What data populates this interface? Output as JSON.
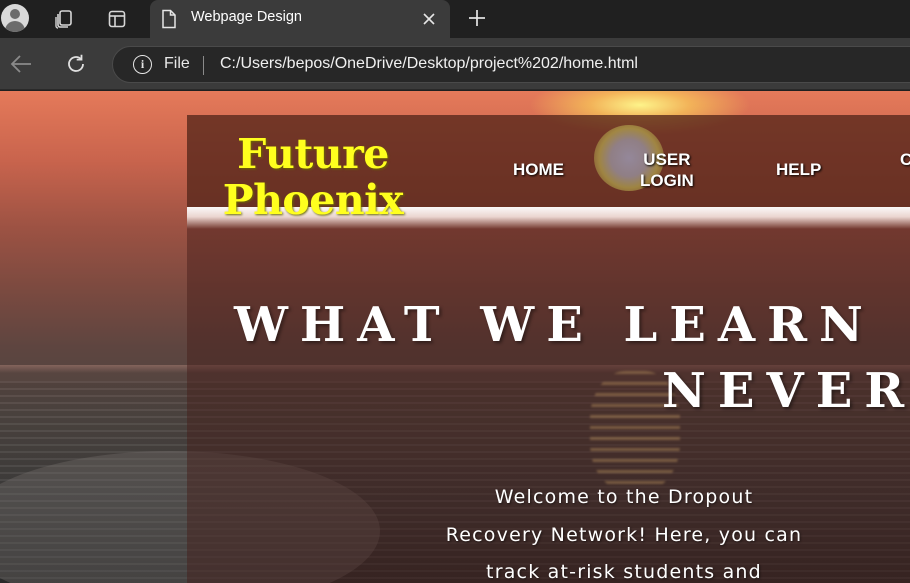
{
  "browser": {
    "tab_title": "Webpage Design",
    "address_scheme": "File",
    "address_url": "C:/Users/bepos/OneDrive/Desktop/project%202/home.html",
    "icons": [
      "profile-avatar-icon",
      "workspaces-icon",
      "tab-actions-icon",
      "document-favicon-icon",
      "close-icon",
      "plus-icon",
      "back-arrow-icon",
      "refresh-icon",
      "info-icon"
    ]
  },
  "site": {
    "brand_line1": "Future",
    "brand_line2": "Phoenix",
    "nav": {
      "home": "HOME",
      "user_login_line1": "USER",
      "user_login_line2": "LOGIN",
      "help": "HELP",
      "partial": "C"
    },
    "hero_line1": "WHAT WE LEARN",
    "hero_line2": "NEVER",
    "welcome_line1": "Welcome to the Dropout",
    "welcome_line2": "Recovery Network! Here, you can",
    "welcome_line3": "track at-risk students and"
  },
  "colors": {
    "brand": "#ffff1e",
    "chrome_dark": "#202020",
    "chrome_toolbar": "#3b3b3b",
    "sunset_top": "#e57a5a"
  }
}
